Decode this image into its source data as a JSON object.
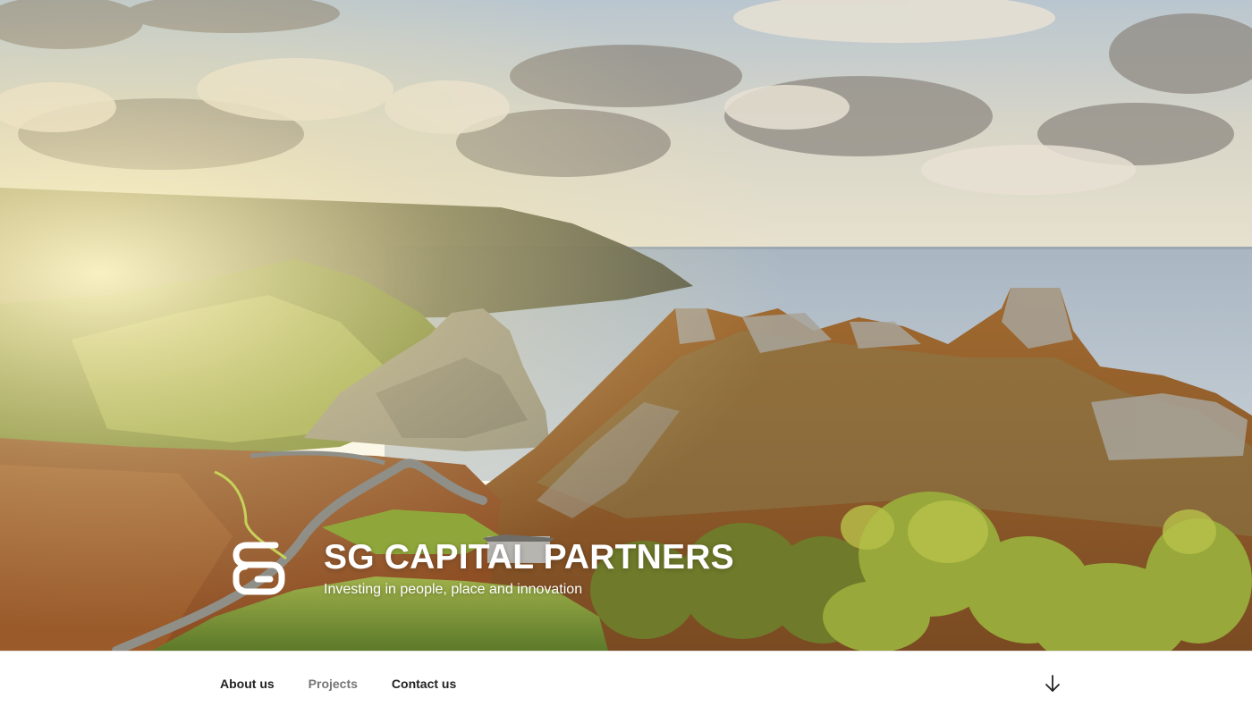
{
  "site": {
    "title": "SG CAPITAL PARTNERS",
    "tagline": "Investing in people, place and innovation",
    "logo_icon": "sg-monogram-logo"
  },
  "nav": {
    "items": [
      {
        "label": "About us",
        "state": "default"
      },
      {
        "label": "Projects",
        "state": "current"
      },
      {
        "label": "Contact us",
        "state": "default"
      }
    ],
    "scroll_icon": "arrow-down-icon"
  },
  "colors": {
    "nav_text": "#222222",
    "nav_text_current": "#767676",
    "brand_text": "#ffffff",
    "nav_background": "#ffffff"
  }
}
